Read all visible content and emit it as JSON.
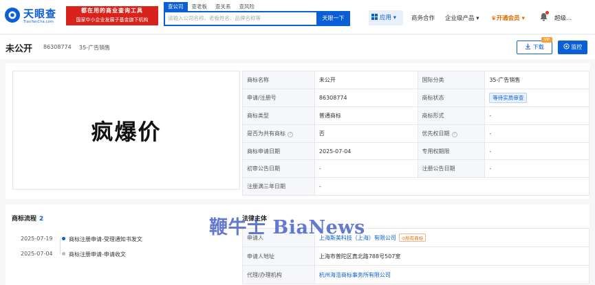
{
  "header": {
    "logo_name": "天眼查",
    "logo_sub": "TianYanCha.com",
    "banner_line1": "都在用的商业查询工具",
    "banner_line2": "国家中小企业发展子基金旗下机构",
    "search_tabs": [
      "查公司",
      "查老板",
      "查关系",
      "查风险"
    ],
    "search_placeholder": "请输入公司名称、老板姓名、品牌名称等",
    "search_button": "天眼一下",
    "apps": "应用",
    "nav": [
      "商务合作",
      "企业级产品",
      "开通会员",
      "超级..."
    ]
  },
  "trademark": {
    "title": "未公开",
    "reg_number": "86308774",
    "class_label": "35-广告销售",
    "download": "下载",
    "vip": "VIP",
    "monitor": "监控",
    "image_text": "疯爆价"
  },
  "info": {
    "rows": [
      [
        "商标名称",
        "未公开",
        "国际分类",
        "35-广告销售"
      ],
      [
        "申请/注册号",
        "86308774",
        "商标状态",
        "等待实质审查"
      ],
      [
        "商标类型",
        "普通商标",
        "商标形式",
        "-"
      ],
      [
        "是否为共有商标",
        "否",
        "优先权日期",
        "-"
      ],
      [
        "商标申请日期",
        "2025-07-04",
        "专用权期限",
        "-"
      ],
      [
        "初审公告日期",
        "-",
        "注册公告日期",
        "-"
      ],
      [
        "注册满三年日期",
        "-"
      ]
    ]
  },
  "flow": {
    "title": "商标流程",
    "count": "2",
    "items": [
      {
        "date": "2025-07-19",
        "text": "商标注册申请-受理通知书发文"
      },
      {
        "date": "2025-07-04",
        "text": "商标注册申请-申请收文"
      }
    ]
  },
  "legal": {
    "title": "法律主体",
    "applicant_label": "申请人",
    "applicant": "上海斯美科技（上海）有限公司",
    "owner_tag": "所有商标",
    "address_label": "申请人地址",
    "address": "上海市普陀区真北路788号507室",
    "agency_label": "代理/办理机构",
    "agency": "杭州海浩商标事务所有限公司"
  },
  "watermark": "鞭牛士 BiaNews",
  "colors": {
    "brand": "#0a5fd6",
    "banner": "#d9221b",
    "vip": "#e06b00"
  }
}
